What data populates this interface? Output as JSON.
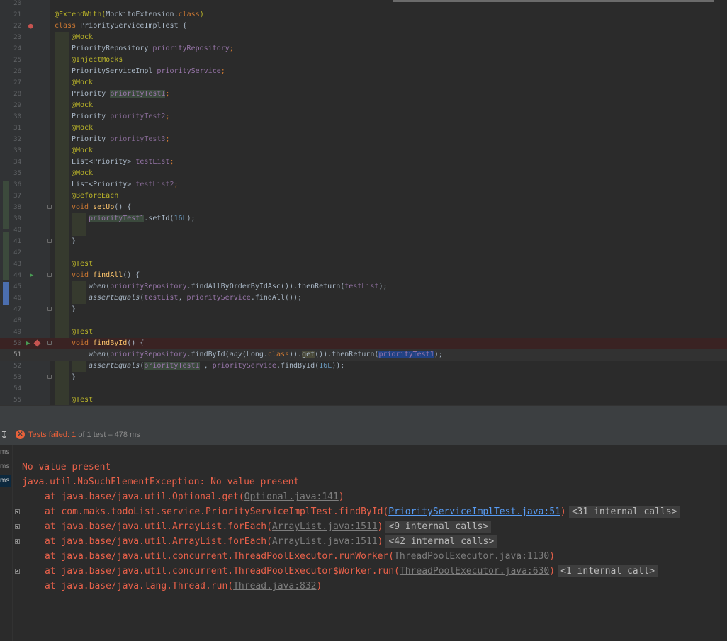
{
  "editor": {
    "lines": [
      {
        "num": "20"
      },
      {
        "num": "21"
      },
      {
        "num": "22"
      },
      {
        "num": "23"
      },
      {
        "num": "24"
      },
      {
        "num": "25"
      },
      {
        "num": "26"
      },
      {
        "num": "27"
      },
      {
        "num": "28"
      },
      {
        "num": "29"
      },
      {
        "num": "30"
      },
      {
        "num": "31"
      },
      {
        "num": "32"
      },
      {
        "num": "33"
      },
      {
        "num": "34"
      },
      {
        "num": "35"
      },
      {
        "num": "36"
      },
      {
        "num": "37"
      },
      {
        "num": "38"
      },
      {
        "num": "39"
      },
      {
        "num": "40"
      },
      {
        "num": "41"
      },
      {
        "num": "42"
      },
      {
        "num": "43"
      },
      {
        "num": "44"
      },
      {
        "num": "45"
      },
      {
        "num": "46"
      },
      {
        "num": "47"
      },
      {
        "num": "48"
      },
      {
        "num": "49"
      },
      {
        "num": "50"
      },
      {
        "num": "51"
      },
      {
        "num": "52"
      },
      {
        "num": "53"
      },
      {
        "num": "54"
      },
      {
        "num": "55"
      }
    ],
    "tokens": {
      "extend_ann": "@ExtendWith(",
      "extend_cls": "MockitoExtension.",
      "extend_kw": "class",
      "extend_close": ")",
      "class_kw": "class",
      "class_name": " PriorityServiceImplTest {",
      "mock": "@Mock",
      "inject": "@InjectMocks",
      "before": "@BeforeEach",
      "test": "@Test",
      "t_repo": "PriorityRepository ",
      "f_repo": "priorityRepository",
      "t_impl": "PriorityServiceImpl ",
      "f_service": "priorityService",
      "t_priority": "Priority ",
      "f_p1": "priorityTest1",
      "f_p2": "priorityTest2",
      "f_p3": "priorityTest3",
      "t_list": "List<Priority> ",
      "f_list": "testList",
      "f_list2": "testList2",
      "semi": ";",
      "void_kw": "void ",
      "m_setup": "setUp",
      "m_findall": "findAll",
      "m_findbyid": "findById",
      "parens_open": "() {",
      "close_brace": "}",
      "setid_call": ".setId(",
      "num_16l": "16L",
      "call_close": ");",
      "when_call": "when",
      "open_paren": "(",
      "find_all_asc": ".findAllByOrderByIdAsc()).thenReturn(",
      "assert_call": "assertEquals",
      "comma_sp": ", ",
      "find_all_call": ".findAll());",
      "find_by_id_call": ".findById(",
      "any_call": "any",
      "long_class": "(Long.",
      "class_word": "class",
      "close_two": ")).",
      "get_call": "get",
      "then_return": "()).thenReturn(",
      "comma_sp2": " , ",
      "find_by_id_close": ".findById(",
      "num_close": "));"
    }
  },
  "run_panel": {
    "status_label": "Tests failed: ",
    "status_count": "1",
    "status_rest": " of 1 test – 478 ms",
    "tree_ms": [
      "ms",
      "ms",
      "ms"
    ]
  },
  "console": {
    "msg1": "No value present",
    "msg2": "java.util.NoSuchElementException: No value present",
    "trace": [
      {
        "prefix": "at java.base/java.util.Optional.get(",
        "link": "Optional.java:141",
        "suffix": ")",
        "internal": ""
      },
      {
        "prefix": "at com.maks.todoList.service.PriorityServiceImplTest.findById(",
        "link": "PriorityServiceImplTest.java:51",
        "suffix": ")",
        "internal": "<31 internal calls>"
      },
      {
        "prefix": "at java.base/java.util.ArrayList.forEach(",
        "link": "ArrayList.java:1511",
        "suffix": ")",
        "internal": "<9 internal calls>"
      },
      {
        "prefix": "at java.base/java.util.ArrayList.forEach(",
        "link": "ArrayList.java:1511",
        "suffix": ")",
        "internal": "<42 internal calls>"
      },
      {
        "prefix": "at java.base/java.util.concurrent.ThreadPoolExecutor.runWorker(",
        "link": "ThreadPoolExecutor.java:1130",
        "suffix": ")",
        "internal": ""
      },
      {
        "prefix": "at java.base/java.util.concurrent.ThreadPoolExecutor$Worker.run(",
        "link": "ThreadPoolExecutor.java:630",
        "suffix": ")",
        "internal": "<1 internal call>"
      },
      {
        "prefix": "at java.base/java.lang.Thread.run(",
        "link": "Thread.java:832",
        "suffix": ")",
        "internal": ""
      }
    ]
  },
  "colors": {
    "error": "#e8614a",
    "background": "#2b2b2b",
    "keyword": "#cc7832",
    "annotation": "#bbb529",
    "field": "#9876aa"
  }
}
